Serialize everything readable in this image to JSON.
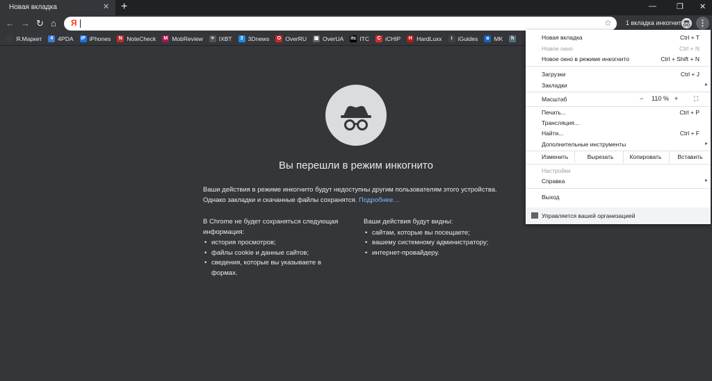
{
  "tab": {
    "title": "Новая вкладка",
    "close": "✕"
  },
  "new_tab": "+",
  "window": {
    "minimize": "—",
    "restore": "❐",
    "close": "✕"
  },
  "toolbar": {
    "back": "←",
    "forward": "→",
    "reload": "↻",
    "home": "⌂",
    "omnibox_icon": "Я",
    "star": "☆",
    "incognito_count": "1 вкладка инкогнито",
    "menu": "⋮"
  },
  "bookmarks": [
    {
      "label": "Я.Маркет",
      "color": "#3a3b3f",
      "glyph": ""
    },
    {
      "label": "4PDA",
      "color": "#3a7bd5",
      "glyph": "4"
    },
    {
      "label": "iPhones",
      "color": "#1a73e8",
      "glyph": "iP"
    },
    {
      "label": "NoteCheck",
      "color": "#c62828",
      "glyph": "N"
    },
    {
      "label": "MobReview",
      "color": "#ad1457",
      "glyph": "M"
    },
    {
      "label": "IXBT",
      "color": "#555555",
      "glyph": "✧"
    },
    {
      "label": "3Dnews",
      "color": "#1e88e5",
      "glyph": "3"
    },
    {
      "label": "OverRU",
      "color": "#c62828",
      "glyph": "O"
    },
    {
      "label": "OverUA",
      "color": "#616161",
      "glyph": "▣"
    },
    {
      "label": "ITC",
      "color": "#000000",
      "glyph": "itc"
    },
    {
      "label": "iCHIP",
      "color": "#d32f2f",
      "glyph": "C"
    },
    {
      "label": "HardLuxx",
      "color": "#b71c1c",
      "glyph": "H"
    },
    {
      "label": "iGuides",
      "color": "#424242",
      "glyph": "i"
    },
    {
      "label": "MK",
      "color": "#1565c0",
      "glyph": "в"
    },
    {
      "label": "",
      "color": "#546e7a",
      "glyph": "h"
    }
  ],
  "page": {
    "heading": "Вы перешли в режим инкогнито",
    "intro": "Ваши действия в режиме инкогнито будут недоступны другим пользователям этого устройства. Однако закладки и скачанные файлы сохранятся.",
    "learn_more": "Подробнее…",
    "left": {
      "title": "В Chrome не будет сохраняться следующая информация:",
      "items": [
        "история просмотров;",
        "файлы cookie и данные сайтов;",
        "сведения, которые вы указываете в формах."
      ]
    },
    "right": {
      "title": "Ваши действия будут видны:",
      "items": [
        "сайтам, которые вы посещаете;",
        "вашему системному администратору;",
        "интернет-провайдеру."
      ]
    }
  },
  "menu": {
    "new_tab": {
      "label": "Новая вкладка",
      "shortcut": "Ctrl + T"
    },
    "new_window": {
      "label": "Новое окно",
      "shortcut": "Ctrl + N"
    },
    "new_incognito": {
      "label": "Новое окно в режиме инкогнито",
      "shortcut": "Ctrl + Shift + N"
    },
    "downloads": {
      "label": "Загрузки",
      "shortcut": "Ctrl + J"
    },
    "bookmarks": {
      "label": "Закладки"
    },
    "zoom": {
      "label": "Масштаб",
      "minus": "−",
      "value": "110 %",
      "plus": "+",
      "fullscreen": "⛶"
    },
    "print": {
      "label": "Печать...",
      "shortcut": "Ctrl + P"
    },
    "cast": {
      "label": "Трансляция..."
    },
    "find": {
      "label": "Найти...",
      "shortcut": "Ctrl + F"
    },
    "more_tools": {
      "label": "Дополнительные инструменты"
    },
    "edit": {
      "label": "Изменить",
      "cut": "Вырезать",
      "copy": "Копировать",
      "paste": "Вставить"
    },
    "settings": {
      "label": "Настройки"
    },
    "help": {
      "label": "Справка"
    },
    "exit": {
      "label": "Выход"
    },
    "managed": "Управляется вашей организацией",
    "arrow": "▸"
  }
}
